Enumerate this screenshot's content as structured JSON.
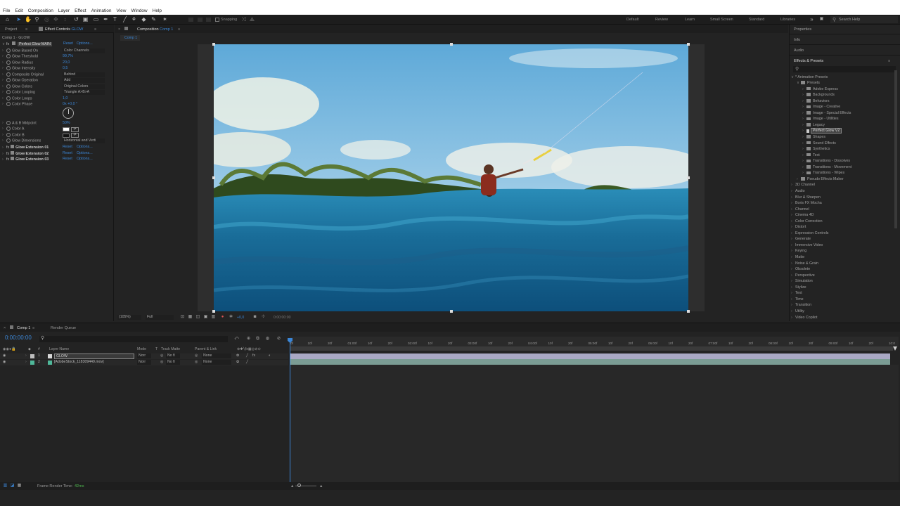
{
  "menu": [
    "File",
    "Edit",
    "Composition",
    "Layer",
    "Effect",
    "Animation",
    "View",
    "Window",
    "Help"
  ],
  "toolbar": {
    "snapping": "Snapping",
    "workspaces": [
      "Default",
      "Review",
      "Learn",
      "Small Screen",
      "Standard",
      "Libraries"
    ],
    "search_placeholder": "Search Help"
  },
  "left_panel": {
    "tab_project": "Project",
    "tab_effect_controls": "Effect Controls",
    "effect_target": "GLOW",
    "breadcrumb": "Comp 1 · GLOW",
    "effect_main": {
      "name": "Perfect Glow MAIN",
      "reset": "Reset",
      "options": "Options..."
    },
    "params": [
      {
        "label": "Glow Based On",
        "dropdown": "Color Channels"
      },
      {
        "label": "Glow Threshold",
        "value": "99,7%"
      },
      {
        "label": "Glow Radius",
        "value": "20,0"
      },
      {
        "label": "Glow Intensity",
        "value": "0,5"
      },
      {
        "label": "Composite Original",
        "dropdown": "Behind"
      },
      {
        "label": "Glow Operation",
        "dropdown": "Add"
      },
      {
        "label": "Glow Colors",
        "dropdown": "Original Colors"
      },
      {
        "label": "Color Looping",
        "dropdown": "Triangle A>B>A"
      },
      {
        "label": "Color Loops",
        "value": "1,0"
      },
      {
        "label": "Color Phase",
        "value": "0x +0,0 °"
      }
    ],
    "params2": [
      {
        "label": "A & B Midpoint",
        "value": "50%"
      },
      {
        "label": "Color A"
      },
      {
        "label": "Color B"
      },
      {
        "label": "Glow Dimensions",
        "dropdown": "Horizontal and Verti"
      }
    ],
    "extensions": [
      {
        "name": "Glow Extension 01",
        "reset": "Reset",
        "options": "Options..."
      },
      {
        "name": "Glow Extension 02",
        "reset": "Reset",
        "options": "Options..."
      },
      {
        "name": "Glow Extension 03",
        "reset": "Reset",
        "options": "Options..."
      }
    ]
  },
  "composition": {
    "tab_label": "Composition",
    "comp_name": "Comp 1",
    "sub_tab": "Comp 1",
    "zoom": "(105%)",
    "resolution": "Full",
    "exposure": "+0,0",
    "timecode": "0:00:00:00"
  },
  "right_panel": {
    "properties": "Properties",
    "info": "Info",
    "audio": "Audio",
    "effects_presets": "Effects & Presets",
    "tree": [
      {
        "label": "* Animation Presets",
        "indent": 0,
        "folder": false,
        "open": true
      },
      {
        "label": "Presets",
        "indent": 1,
        "folder": true,
        "open": true
      },
      {
        "label": "Adobe Express",
        "indent": 2,
        "folder": true
      },
      {
        "label": "Backgrounds",
        "indent": 2,
        "folder": true
      },
      {
        "label": "Behaviors",
        "indent": 2,
        "folder": true
      },
      {
        "label": "Image - Creative",
        "indent": 2,
        "folder": true
      },
      {
        "label": "Image - Special Effects",
        "indent": 2,
        "folder": true
      },
      {
        "label": "Image - Utilities",
        "indent": 2,
        "folder": true
      },
      {
        "label": "Legacy",
        "indent": 2,
        "folder": true
      },
      {
        "label": "Perfect Glow V2",
        "indent": 2,
        "folder": false,
        "selected": true
      },
      {
        "label": "Shapes",
        "indent": 2,
        "folder": true
      },
      {
        "label": "Sound Effects",
        "indent": 2,
        "folder": true
      },
      {
        "label": "Synthetics",
        "indent": 2,
        "folder": true
      },
      {
        "label": "Text",
        "indent": 2,
        "folder": true
      },
      {
        "label": "Transitions - Dissolves",
        "indent": 2,
        "folder": true
      },
      {
        "label": "Transitions - Movement",
        "indent": 2,
        "folder": true
      },
      {
        "label": "Transitions - Wipes",
        "indent": 2,
        "folder": true
      },
      {
        "label": "Pseudo Effects Maker",
        "indent": 1,
        "folder": true
      },
      {
        "label": "3D Channel",
        "indent": 0
      },
      {
        "label": "Audio",
        "indent": 0
      },
      {
        "label": "Blur & Sharpen",
        "indent": 0
      },
      {
        "label": "Boris FX Mocha",
        "indent": 0
      },
      {
        "label": "Channel",
        "indent": 0
      },
      {
        "label": "Cinema 4D",
        "indent": 0
      },
      {
        "label": "Color Correction",
        "indent": 0
      },
      {
        "label": "Distort",
        "indent": 0
      },
      {
        "label": "Expression Controls",
        "indent": 0
      },
      {
        "label": "Generate",
        "indent": 0
      },
      {
        "label": "Immersive Video",
        "indent": 0
      },
      {
        "label": "Keying",
        "indent": 0
      },
      {
        "label": "Matte",
        "indent": 0
      },
      {
        "label": "Noise & Grain",
        "indent": 0
      },
      {
        "label": "Obsolete",
        "indent": 0
      },
      {
        "label": "Perspective",
        "indent": 0
      },
      {
        "label": "Simulation",
        "indent": 0
      },
      {
        "label": "Stylize",
        "indent": 0
      },
      {
        "label": "Text",
        "indent": 0
      },
      {
        "label": "Time",
        "indent": 0
      },
      {
        "label": "Transition",
        "indent": 0
      },
      {
        "label": "Utility",
        "indent": 0
      },
      {
        "label": "Video Copilot",
        "indent": 0
      }
    ]
  },
  "timeline": {
    "tab_comp": "Comp 1",
    "tab_render": "Render Queue",
    "timecode": "0:00:00:00",
    "headers": {
      "layer_name": "Layer Name",
      "mode": "Mode",
      "t": "T",
      "track_matte": "Track Matte",
      "parent": "Parent & Link"
    },
    "layers": [
      {
        "num": "1",
        "name": "GLOW",
        "mode": "Norr",
        "matte": "No fi",
        "parent": "None",
        "color": "#d8d8d8"
      },
      {
        "num": "2",
        "name": "[AdobeStock_118309449.mov]",
        "mode": "Norr",
        "matte": "No fi",
        "parent": "None",
        "color": "#4fb89a"
      }
    ],
    "ruler": [
      "0f",
      "10f",
      "20f",
      "01:00f",
      "10f",
      "20f",
      "02:00f",
      "10f",
      "20f",
      "03:00f",
      "10f",
      "20f",
      "04:00f",
      "10f",
      "20f",
      "05:00f",
      "10f",
      "20f",
      "06:00f",
      "10f",
      "20f",
      "07:00f",
      "10f",
      "20f",
      "08:00f",
      "10f",
      "20f",
      "09:00f",
      "10f",
      "20f",
      "10:0"
    ]
  },
  "status": {
    "label": "Frame Render Time:",
    "value": "42ms"
  },
  "colors": {
    "accent": "#3b86d6",
    "bg": "#232323",
    "panel": "#1d1d1d",
    "layer_bar": "#a9a8c4"
  }
}
